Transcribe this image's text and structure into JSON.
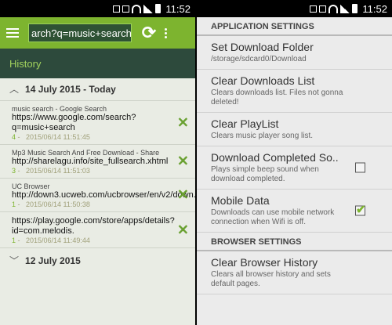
{
  "status": {
    "time": "11:52"
  },
  "browser": {
    "url": "arch?q=music+search",
    "history_title": "History",
    "groups": [
      {
        "date": "14 July 2015 - Today",
        "items": [
          {
            "title": "music search - Google Search",
            "url": "https://www.google.com/search?q=music+search",
            "count": "4",
            "time": "2015/06/14 11:51:45"
          },
          {
            "title": "Mp3 Music Search And Free Download - Share",
            "url": "http://sharelagu.info/site_fullsearch.xhtml",
            "count": "3",
            "time": "2015/06/14 11:51:03"
          },
          {
            "title": "UC Browser",
            "url": "http://down3.ucweb.com/ucbrowser/en/v2/down.",
            "count": "1",
            "time": "2015/06/14 11:50:38"
          },
          {
            "title": "",
            "url": "https://play.google.com/store/apps/details?id=com.melodis.",
            "count": "1",
            "time": "2015/06/14 11:49:44"
          }
        ]
      },
      {
        "date": "12 July 2015"
      }
    ]
  },
  "settings": {
    "app_header": "APPLICATION SETTINGS",
    "browser_header": "BROWSER SETTINGS",
    "items": [
      {
        "title": "Set Download Folder",
        "subtitle": "/storage/sdcard0/Download"
      },
      {
        "title": "Clear Downloads List",
        "subtitle": "Clears downloads list. Files not gonna deleted!"
      },
      {
        "title": "Clear PlayList",
        "subtitle": "Clears music player song list."
      },
      {
        "title": "Download Completed So..",
        "subtitle": "Plays simple beep sound when download completed.",
        "checked": false
      },
      {
        "title": "Mobile Data",
        "subtitle": "Downloads can use mobile network connection when Wifi is off.",
        "checked": true
      }
    ],
    "browser_items": [
      {
        "title": "Clear Browser History",
        "subtitle": "Clears all browser history and sets default pages."
      }
    ]
  }
}
